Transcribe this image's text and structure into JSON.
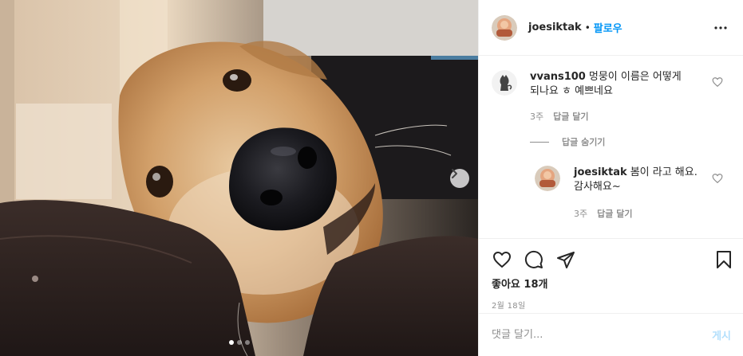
{
  "post": {
    "author": "joesiktak",
    "separator": "•",
    "follow_label": "팔로우",
    "likes_text": "좋아요 18개",
    "date_text": "2월 18일",
    "image_count": 3,
    "active_image": 1
  },
  "comments": [
    {
      "username": "vvans100",
      "text": "멍뭉이 이름은 어떻게 되나요 ㅎ 예쁘네요",
      "time": "3주",
      "reply_label": "답글 달기"
    }
  ],
  "replies_toggle": {
    "label": "답글 숨기기"
  },
  "replies": [
    {
      "username": "joesiktak",
      "text": "봄이 라고 해요. 감사해요~",
      "time": "3주",
      "reply_label": "답글 달기"
    }
  ],
  "composer": {
    "placeholder": "댓글 달기...",
    "post_label": "게시"
  },
  "icons": {
    "more": "more-horizontal-icon",
    "like": "heart-icon",
    "comment": "comment-bubble-icon",
    "share": "paper-plane-icon",
    "save": "bookmark-icon",
    "next": "chevron-right-icon"
  },
  "colors": {
    "accent": "#0095f6",
    "muted": "#8e8e8e",
    "post_disabled": "#b2dffc"
  }
}
